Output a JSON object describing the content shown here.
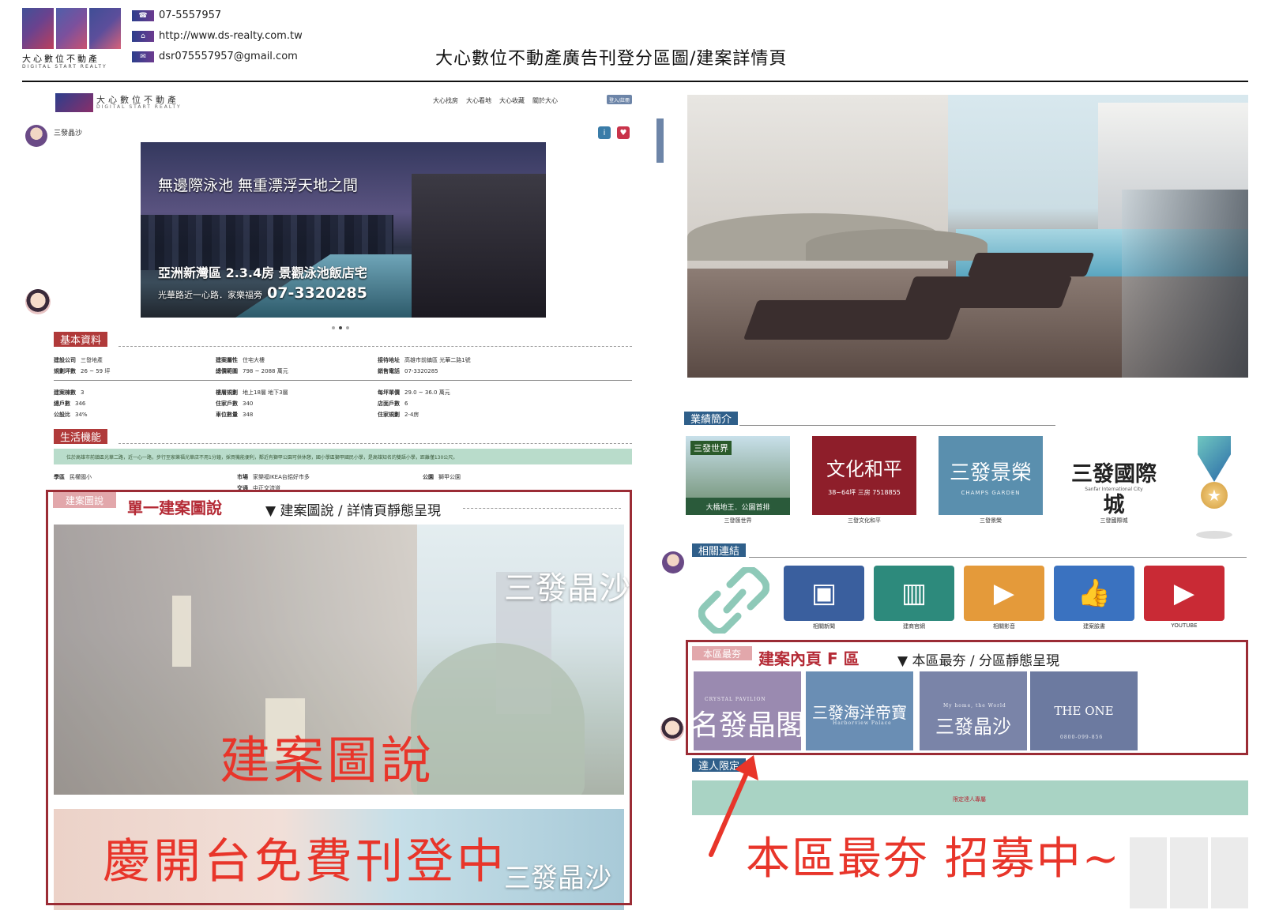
{
  "header": {
    "logo_name": "大心數位不動產",
    "logo_sub": "DIGITAL START REALTY",
    "phone": "07-5557957",
    "website": "http://www.ds-realty.com.tw",
    "email": "dsr075557957@gmail.com",
    "title": "大心數位不動產廣告刊登分區圖/建案詳情頁"
  },
  "left_page": {
    "logo_name": "大心數位不動產",
    "logo_sub": "DIGITAL START REALTY",
    "nav": [
      "大心找房",
      "大心看地",
      "大心收藏",
      "關於大心"
    ],
    "login": "登入/註冊",
    "project_name": "三發晶沙",
    "hero": {
      "headline": "無邊際泳池  無重漂浮天地之間",
      "sub": "亞洲新灣區 2.3.4房 景觀泳池飯店宅",
      "address": "光華路近一心路．家樂福旁",
      "phone": "07-3320285"
    },
    "basic_info_tag": "基本資料",
    "basic_info": [
      {
        "k": "建設公司",
        "v": "三發地產"
      },
      {
        "k": "規劃坪數",
        "v": "26 ~ 59 坪"
      },
      {
        "k": "建案屬性",
        "v": "住宅大樓"
      },
      {
        "k": "總價範圍",
        "v": "798 ~ 2088 萬元"
      },
      {
        "k": "接待地址",
        "v": "高雄市前鎮區 光華二路1號"
      },
      {
        "k": "銷售電話",
        "v": "07-3320285"
      },
      {
        "k": "建案棟數",
        "v": "3"
      },
      {
        "k": "總戶數",
        "v": "346"
      },
      {
        "k": "公設比",
        "v": "34%"
      },
      {
        "k": "樓層規劃",
        "v": "地上18層 地下3層"
      },
      {
        "k": "住家戶數",
        "v": "340"
      },
      {
        "k": "車位數量",
        "v": "348"
      },
      {
        "k": "每坪單價",
        "v": "29.0 ~ 36.0 萬元"
      },
      {
        "k": "店面戶數",
        "v": "6"
      },
      {
        "k": "住家規劃",
        "v": "2-4房"
      }
    ],
    "life_tag": "生活機能",
    "life_text": "位於高雄市前鎮區光華二路，近一心一路，步行至家樂福光華店不用1分鐘，採買機能便利，鄰近有獅甲公園可供休憩，國小學區獅甲國民小學，是高雄知名的雙語小學，距離僅130公尺。",
    "life_rows": [
      {
        "k": "學區",
        "v": "民權國小"
      },
      {
        "k": "市場",
        "v": "家樂福IKEA台鋁好市多"
      },
      {
        "k": "公園",
        "v": "獅甲公園"
      },
      {
        "k": "交通",
        "v": "中正交流道"
      }
    ],
    "gallery_tag": "建案圖說",
    "gallery_heading": "單一建案圖說",
    "gallery_sub": "▼ 建案圖說 / 詳情頁靜態呈現",
    "brand": "三發晶沙",
    "big_red_1": "建案圖說",
    "big_red_2": "慶開台免費刊登中"
  },
  "right_page": {
    "perf_tag": "業績簡介",
    "perf_items": [
      {
        "title": "三發世界",
        "tagline": "大橋地王．公園首排",
        "caption": "三發匯世界"
      },
      {
        "title": "文化和平",
        "tagline": "38~64坪 三房  7518855",
        "caption": "三發文化和平"
      },
      {
        "title": "三發景榮",
        "tagline": "CHAMPS GARDEN",
        "caption": "三發景榮"
      },
      {
        "title": "三發國際城",
        "tagline": "Sanfar International City",
        "caption": "三發國際城"
      }
    ],
    "links_tag": "相關連結",
    "links": [
      {
        "icon": "newspaper-icon",
        "caption": "相關新聞",
        "color": "#3a5f9e"
      },
      {
        "icon": "building-icon",
        "caption": "建商官網",
        "color": "#2d8a7c"
      },
      {
        "icon": "video-camera-icon",
        "caption": "相關影音",
        "color": "#e49a3a"
      },
      {
        "icon": "thumbs-up-icon",
        "caption": "建案臉書",
        "color": "#3a72c0"
      },
      {
        "icon": "youtube-icon",
        "caption": "YOUTUBE",
        "color": "#c92a35"
      }
    ],
    "best_tag": "本區最夯",
    "best_heading": "建案內頁 F 區",
    "best_sub": "▼ 本區最夯 / 分區靜態呈現",
    "best_items": [
      {
        "title": "名發晶閣",
        "small": "CRYSTAL PAVILION"
      },
      {
        "title": "三發海洋帝寶",
        "small": "Harborview Palace"
      },
      {
        "title": "三發晶沙",
        "small": "My home, the World"
      },
      {
        "title": "THE ONE",
        "small": "0800-099-856"
      }
    ],
    "vip_tag": "達人限定",
    "vip_link": "限定達人專屬",
    "big_red": "本區最夯 招募中~"
  },
  "colors": {
    "brand_red": "#b03a3a",
    "tag_blue": "#2f5f8a",
    "highlight_red": "#9b2c35",
    "annotation_red": "#e8352a",
    "mint": "#a9d3c4"
  }
}
